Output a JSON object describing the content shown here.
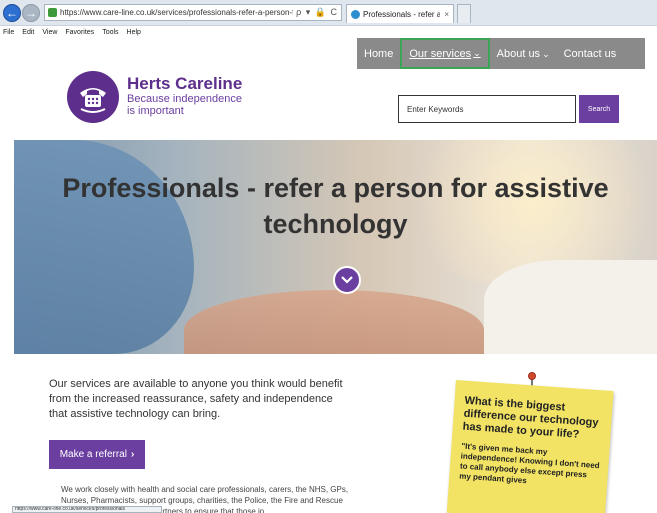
{
  "browser": {
    "url": "https://www.care-line.co.uk/services/professionals-refer-a-person-for-assistive-techno",
    "address_tools": "ρ ▾ 🔒 C",
    "tab_title": "Professionals - refer a pers...",
    "tab_close": "×",
    "menu": [
      "File",
      "Edit",
      "View",
      "Favorites",
      "Tools",
      "Help"
    ]
  },
  "nav": {
    "items": [
      {
        "label": "Home"
      },
      {
        "label": "Our services"
      },
      {
        "label": "About us"
      },
      {
        "label": "Contact us"
      }
    ],
    "active_index": 1
  },
  "logo": {
    "title": "Herts Careline",
    "tagline_line1": "Because independence",
    "tagline_line2": "is important",
    "icon": "telephone-icon"
  },
  "search": {
    "placeholder": "Enter Keywords",
    "button_label": "Search"
  },
  "hero": {
    "title": "Professionals - refer a person for assistive technology",
    "scroll_icon": "chevron-down-icon"
  },
  "main": {
    "intro": "Our services are available to anyone you think would benefit from the increased reassurance, safety and independence that assistive technology can bring.",
    "referral_label": "Make a referral",
    "referral_arrow": "›",
    "body": "We work closely with health and social care professionals, carers, the NHS, GPs, Nurses, Pharmacists, support groups, charities, the Police, the Fire and Rescue Service and other referral partners to ensure that those in"
  },
  "status_bar": "https://www.care-line.co.uk/services/professionals",
  "note": {
    "question": "What is the biggest difference our technology has made to your life?",
    "quote": "\"It's given me back my independence! Knowing I don't need to call anybody else except press my pendant gives"
  },
  "colors": {
    "brand_purple": "#6b3fa0",
    "nav_grey": "#8a8a8a",
    "active_outline": "#3aa655",
    "note_yellow": "#f2e365"
  }
}
